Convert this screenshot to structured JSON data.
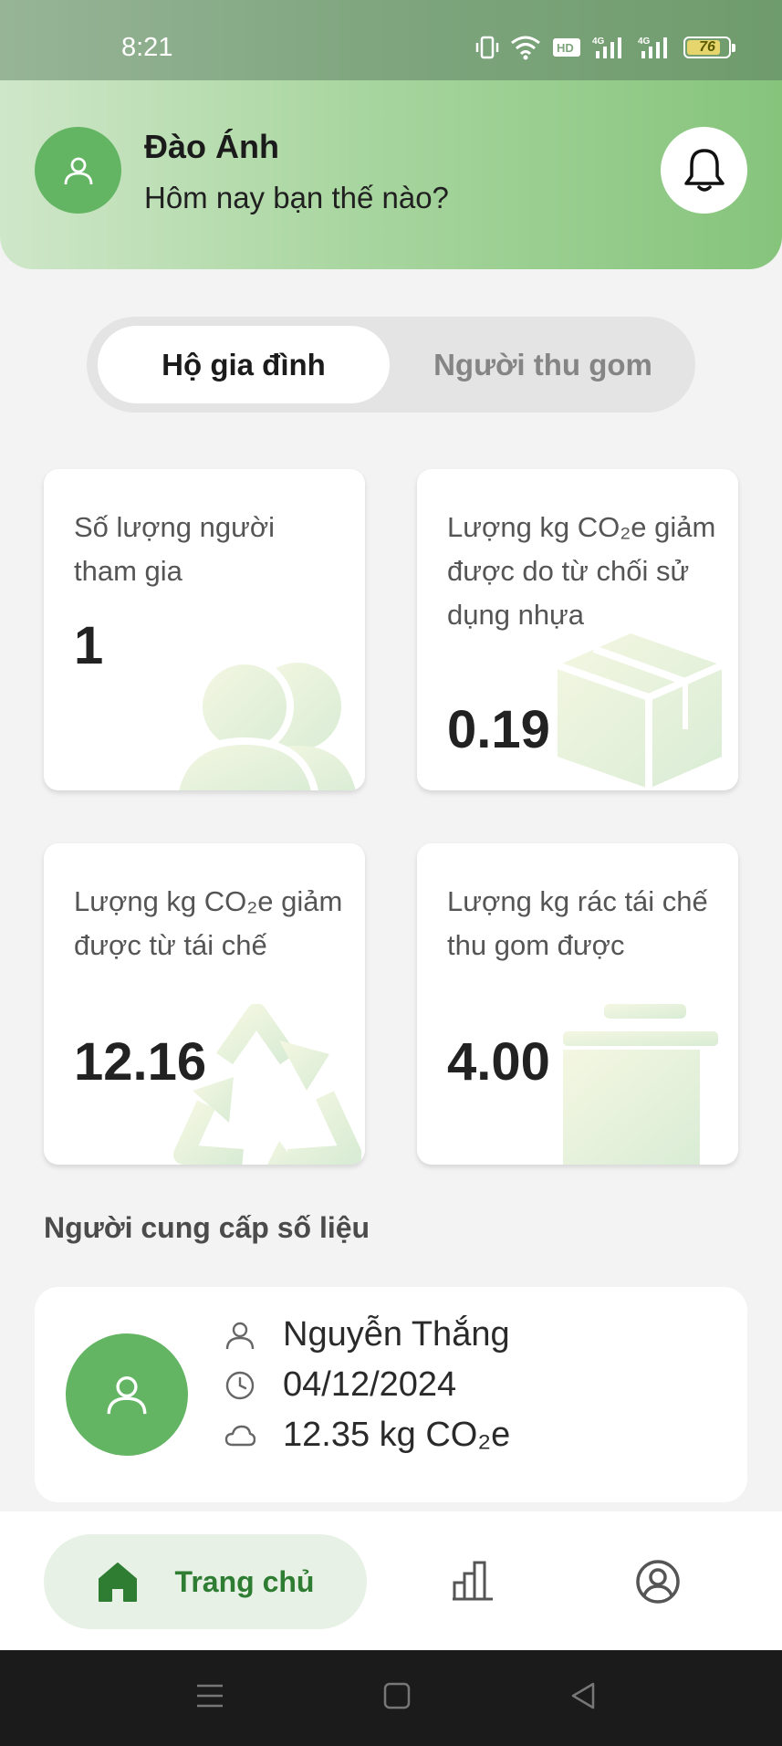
{
  "status_bar": {
    "time": "8:21",
    "battery": "76",
    "battery_level_percent": 76,
    "network_label": "4G",
    "hd_label": "HD"
  },
  "header": {
    "user_name": "Đào Ánh",
    "greeting": "Hôm nay bạn thế nào?"
  },
  "segment": {
    "options": [
      "Hộ gia đình",
      "Người thu gom"
    ],
    "selected": "Hộ gia đình"
  },
  "stats": [
    {
      "label": "Số lượng người tham gia",
      "value": "1",
      "icon": "people-icon"
    },
    {
      "label": "Lượng kg CO₂e giảm được do từ chối sử dụng nhựa",
      "value": "0.19",
      "icon": "box-icon"
    },
    {
      "label": "Lượng kg CO₂e giảm được từ tái chế",
      "value": "12.16",
      "icon": "recycle-icon"
    },
    {
      "label": "Lượng kg rác tái chế thu gom được",
      "value": "4.00",
      "icon": "trash-bin-icon"
    }
  ],
  "provider_section": {
    "title": "Người cung cấp số liệu",
    "name": "Nguyễn Thắng",
    "date": "04/12/2024",
    "amount": "12.35 kg CO₂e"
  },
  "bottom_nav": {
    "items": [
      {
        "label": "Trang chủ",
        "icon": "home-icon",
        "active": true
      },
      {
        "label": "",
        "icon": "bar-chart-icon",
        "active": false
      },
      {
        "label": "",
        "icon": "account-icon",
        "active": false
      }
    ]
  },
  "colors": {
    "accent": "#63b563",
    "header_gradient_end": "#86c47c",
    "active_nav_text": "#2e7d32"
  }
}
